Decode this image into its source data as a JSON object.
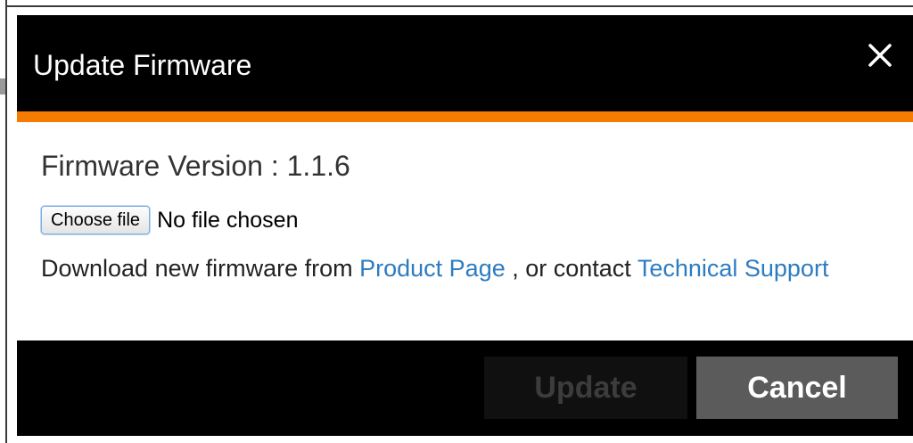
{
  "dialog": {
    "title": "Update Firmware",
    "close_icon": "close-icon",
    "accent_color": "#f57c00"
  },
  "body": {
    "firmware_version_text": "Firmware Version : 1.1.6",
    "file_input": {
      "button_label": "Choose file",
      "status_text": "No file chosen"
    },
    "download_prefix": "Download new firmware from ",
    "product_page_link": "Product Page",
    "download_middle": " , or contact ",
    "support_link": "Technical Support"
  },
  "footer": {
    "update_label": "Update",
    "update_enabled": false,
    "cancel_label": "Cancel"
  }
}
